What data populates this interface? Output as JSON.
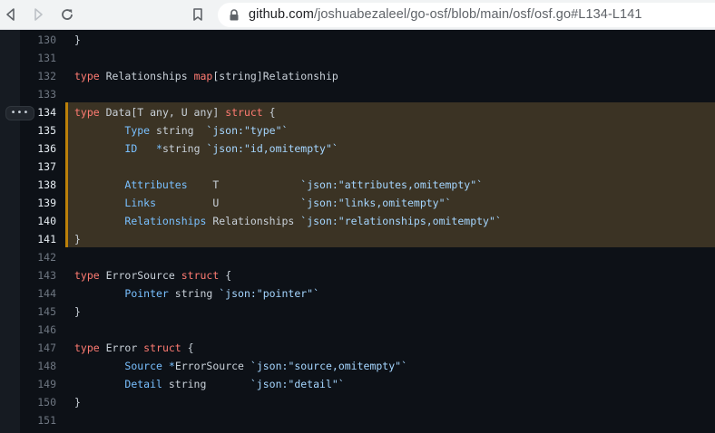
{
  "browser": {
    "url_host": "github.com",
    "url_path": "/joshuabezaleel/go-osf/blob/main/osf/osf.go#L134-L141"
  },
  "code": {
    "lines": [
      {
        "n": "130",
        "parts": [
          {
            "t": "}",
            "c": "plain"
          }
        ]
      },
      {
        "n": "131",
        "parts": []
      },
      {
        "n": "132",
        "parts": [
          {
            "t": "type",
            "c": "kw"
          },
          {
            "t": " Relationships ",
            "c": "plain"
          },
          {
            "t": "map",
            "c": "kw"
          },
          {
            "t": "[string]Relationship",
            "c": "plain"
          }
        ]
      },
      {
        "n": "133",
        "parts": []
      },
      {
        "n": "134",
        "hl": true,
        "parts": [
          {
            "t": "type",
            "c": "kw"
          },
          {
            "t": " Data[T any, U any] ",
            "c": "plain"
          },
          {
            "t": "struct",
            "c": "kw"
          },
          {
            "t": " {",
            "c": "plain"
          }
        ]
      },
      {
        "n": "135",
        "hl": true,
        "parts": [
          {
            "t": "        ",
            "c": "plain"
          },
          {
            "t": "Type",
            "c": "fld"
          },
          {
            "t": " string  ",
            "c": "plain"
          },
          {
            "t": "`json:\"type\"`",
            "c": "str"
          }
        ]
      },
      {
        "n": "136",
        "hl": true,
        "parts": [
          {
            "t": "        ",
            "c": "plain"
          },
          {
            "t": "ID",
            "c": "fld"
          },
          {
            "t": "   ",
            "c": "plain"
          },
          {
            "t": "*",
            "c": "fld"
          },
          {
            "t": "string ",
            "c": "plain"
          },
          {
            "t": "`json:\"id,omitempty\"`",
            "c": "str"
          }
        ]
      },
      {
        "n": "137",
        "hl": true,
        "parts": []
      },
      {
        "n": "138",
        "hl": true,
        "parts": [
          {
            "t": "        ",
            "c": "plain"
          },
          {
            "t": "Attributes",
            "c": "fld"
          },
          {
            "t": "    T             ",
            "c": "plain"
          },
          {
            "t": "`json:\"attributes,omitempty\"`",
            "c": "str"
          }
        ]
      },
      {
        "n": "139",
        "hl": true,
        "parts": [
          {
            "t": "        ",
            "c": "plain"
          },
          {
            "t": "Links",
            "c": "fld"
          },
          {
            "t": "         U             ",
            "c": "plain"
          },
          {
            "t": "`json:\"links,omitempty\"`",
            "c": "str"
          }
        ]
      },
      {
        "n": "140",
        "hl": true,
        "parts": [
          {
            "t": "        ",
            "c": "plain"
          },
          {
            "t": "Relationships",
            "c": "fld"
          },
          {
            "t": " Relationships ",
            "c": "plain"
          },
          {
            "t": "`json:\"relationships,omitempty\"`",
            "c": "str"
          }
        ]
      },
      {
        "n": "141",
        "hl": true,
        "parts": [
          {
            "t": "}",
            "c": "plain"
          }
        ]
      },
      {
        "n": "142",
        "parts": []
      },
      {
        "n": "143",
        "parts": [
          {
            "t": "type",
            "c": "kw"
          },
          {
            "t": " ErrorSource ",
            "c": "plain"
          },
          {
            "t": "struct",
            "c": "kw"
          },
          {
            "t": " {",
            "c": "plain"
          }
        ]
      },
      {
        "n": "144",
        "parts": [
          {
            "t": "        ",
            "c": "plain"
          },
          {
            "t": "Pointer",
            "c": "fld"
          },
          {
            "t": " string ",
            "c": "plain"
          },
          {
            "t": "`json:\"pointer\"`",
            "c": "str"
          }
        ]
      },
      {
        "n": "145",
        "parts": [
          {
            "t": "}",
            "c": "plain"
          }
        ]
      },
      {
        "n": "146",
        "parts": []
      },
      {
        "n": "147",
        "parts": [
          {
            "t": "type",
            "c": "kw"
          },
          {
            "t": " Error ",
            "c": "plain"
          },
          {
            "t": "struct",
            "c": "kw"
          },
          {
            "t": " {",
            "c": "plain"
          }
        ]
      },
      {
        "n": "148",
        "parts": [
          {
            "t": "        ",
            "c": "plain"
          },
          {
            "t": "Source",
            "c": "fld"
          },
          {
            "t": " ",
            "c": "plain"
          },
          {
            "t": "*",
            "c": "fld"
          },
          {
            "t": "ErrorSource ",
            "c": "plain"
          },
          {
            "t": "`json:\"source,omitempty\"`",
            "c": "str"
          }
        ]
      },
      {
        "n": "149",
        "parts": [
          {
            "t": "        ",
            "c": "plain"
          },
          {
            "t": "Detail",
            "c": "fld"
          },
          {
            "t": " string       ",
            "c": "plain"
          },
          {
            "t": "`json:\"detail\"`",
            "c": "str"
          }
        ]
      },
      {
        "n": "150",
        "parts": [
          {
            "t": "}",
            "c": "plain"
          }
        ]
      },
      {
        "n": "151",
        "parts": []
      }
    ]
  }
}
